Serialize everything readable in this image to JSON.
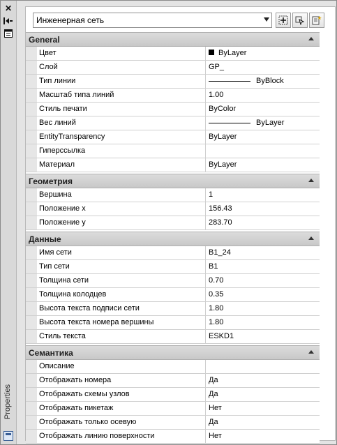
{
  "strip": {
    "close_glyph": "✕",
    "pin_glyph": "◂|",
    "menu_glyph": "▤",
    "title": "Properties"
  },
  "toolbar": {
    "object_type": "Инженерная сеть",
    "btn_toggle_pickadd_icon": "pickadd-icon",
    "btn_select_objects_icon": "select-objects-icon",
    "btn_quick_select_icon": "quick-select-icon"
  },
  "sections": [
    {
      "title": "General",
      "rows": [
        {
          "name": "Цвет",
          "value": "ByLayer",
          "kind": "color"
        },
        {
          "name": "Слой",
          "value": "GP_"
        },
        {
          "name": "Тип линии",
          "value": "ByBlock",
          "kind": "line"
        },
        {
          "name": "Масштаб типа линий",
          "value": "1.00"
        },
        {
          "name": "Стиль печати",
          "value": "ByColor"
        },
        {
          "name": "Вес линий",
          "value": "ByLayer",
          "kind": "line"
        },
        {
          "name": "EntityTransparency",
          "value": "ByLayer"
        },
        {
          "name": "Гиперссылка",
          "value": ""
        },
        {
          "name": "Материал",
          "value": "ByLayer"
        }
      ]
    },
    {
      "title": "Геометрия",
      "rows": [
        {
          "name": "Вершина",
          "value": "1"
        },
        {
          "name": "Положение x",
          "value": "156.43"
        },
        {
          "name": "Положение y",
          "value": "283.70"
        }
      ]
    },
    {
      "title": "Данные",
      "rows": [
        {
          "name": "Имя сети",
          "value": "B1_24"
        },
        {
          "name": "Тип сети",
          "value": "B1"
        },
        {
          "name": "Толщина сети",
          "value": "0.70"
        },
        {
          "name": "Толщина колодцев",
          "value": "0.35"
        },
        {
          "name": "Высота текста подписи сети",
          "value": "1.80"
        },
        {
          "name": "Высота текста номера вершины",
          "value": "1.80"
        },
        {
          "name": "Стиль текста",
          "value": "ESKD1"
        }
      ]
    },
    {
      "title": "Семантика",
      "rows": [
        {
          "name": "Описание",
          "value": ""
        },
        {
          "name": "Отображать номера",
          "value": "Да"
        },
        {
          "name": "Отображать схемы узлов",
          "value": "Да"
        },
        {
          "name": "Отображать пикетаж",
          "value": "Нет"
        },
        {
          "name": "Отображать только осевую",
          "value": "Да"
        },
        {
          "name": "Отображать линию поверхности",
          "value": "Нет"
        }
      ]
    }
  ]
}
